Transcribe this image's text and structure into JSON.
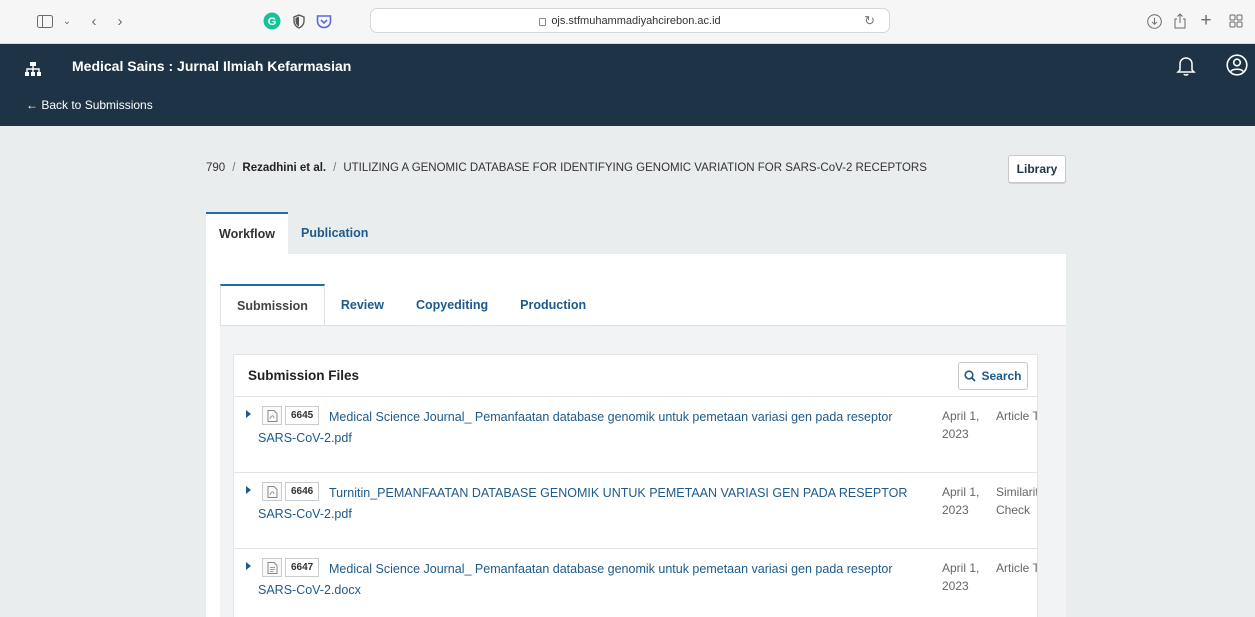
{
  "browser": {
    "url": "ojs.stfmuhammadiyahcirebon.ac.id"
  },
  "header": {
    "journal_title": "Medical Sains : Jurnal Ilmiah Kefarmasian",
    "back_link": "← Back to Submissions"
  },
  "breadcrumb": {
    "id": "790",
    "separator": "/",
    "authors": "Rezadhini et al.",
    "title": "UTILIZING A GENOMIC DATABASE FOR IDENTIFYING GENOMIC VARIATION FOR SARS-CoV-2 RECEPTORS"
  },
  "library_label": "Library",
  "main_tabs": [
    {
      "label": "Workflow"
    },
    {
      "label": "Publication"
    }
  ],
  "sub_tabs": [
    {
      "label": "Submission"
    },
    {
      "label": "Review"
    },
    {
      "label": "Copyediting"
    },
    {
      "label": "Production"
    }
  ],
  "submission_files": {
    "title": "Submission Files",
    "search_label": "Search",
    "rows": [
      {
        "id": "6645",
        "icon": "pdf-file-icon",
        "name": "Medical Science Journal_ Pemanfaatan database genomik untuk pemetaan variasi gen pada reseptor SARS-CoV-2.pdf",
        "date": "April 1, 2023",
        "type": "Article Text"
      },
      {
        "id": "6646",
        "icon": "pdf-file-icon",
        "name": "Turnitin_PEMANFAATAN DATABASE GENOMIK UNTUK PEMETAAN VARIASI GEN PADA RESEPTOR SARS-CoV-2.pdf",
        "date": "April 1, 2023",
        "type": "Similarity Check"
      },
      {
        "id": "6647",
        "icon": "doc-file-icon",
        "name": "Medical Science Journal_ Pemanfaatan database genomik untuk pemetaan variasi gen pada reseptor SARS-CoV-2.docx",
        "date": "April 1, 2023",
        "type": "Article Text"
      }
    ]
  }
}
